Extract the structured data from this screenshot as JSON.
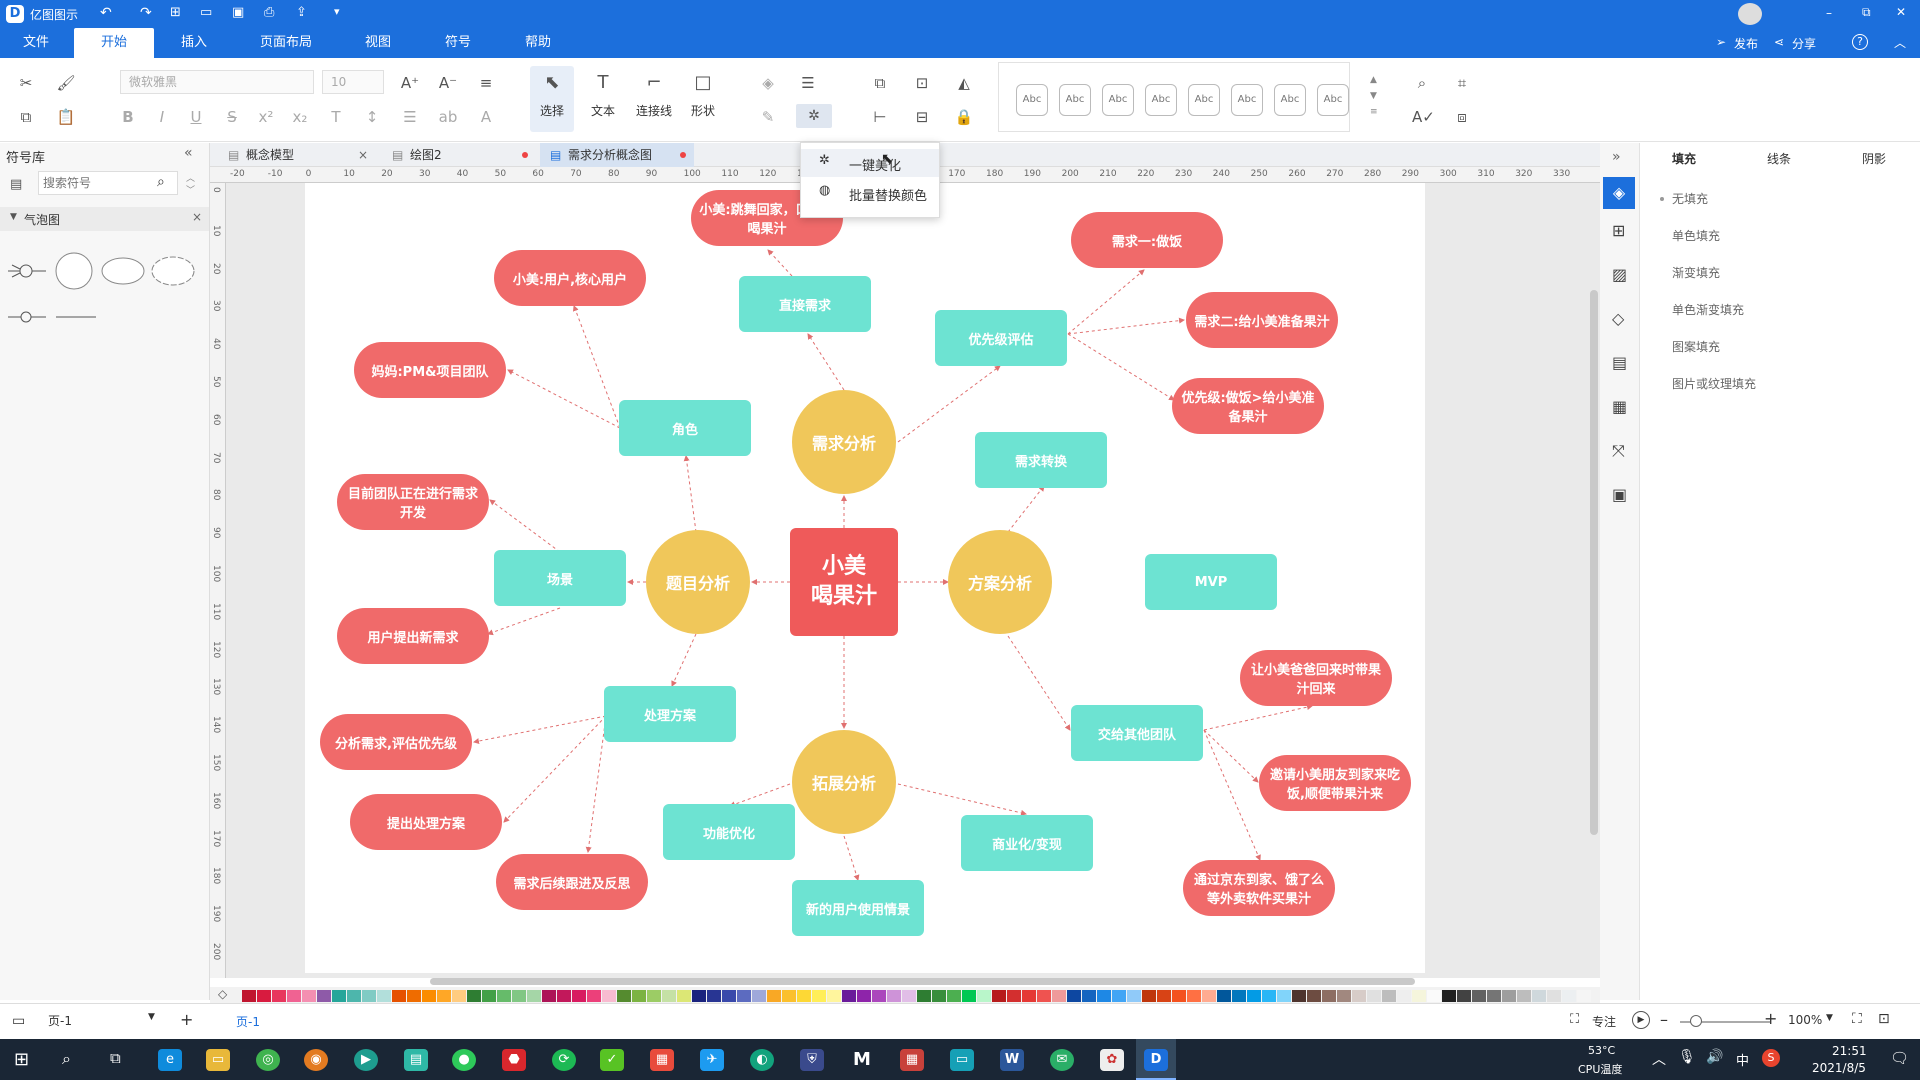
{
  "app": {
    "title": "亿图图示"
  },
  "window_controls": {
    "minimize": "–",
    "restore": "⧉",
    "close": "✕"
  },
  "menu": {
    "tabs": [
      "文件",
      "开始",
      "插入",
      "页面布局",
      "视图",
      "符号",
      "帮助"
    ],
    "active": "开始",
    "publish": "发布",
    "share": "分享",
    "help": "?"
  },
  "ribbon": {
    "font_family": "微软雅黑",
    "font_size": "10",
    "tools": [
      "选择",
      "文本",
      "连接线",
      "形状"
    ],
    "style_swatches": [
      "Abc",
      "Abc",
      "Abc",
      "Abc",
      "Abc",
      "Abc",
      "Abc",
      "Abc"
    ]
  },
  "context_menu": {
    "items": [
      "一键美化",
      "批量替换颜色"
    ]
  },
  "symbol_library": {
    "title": "符号库",
    "search_placeholder": "搜索符号",
    "category": "气泡图"
  },
  "doc_tabs": [
    {
      "label": "概念模型",
      "close": "×"
    },
    {
      "label": "绘图2",
      "dot": true
    },
    {
      "label": "需求分析概念图",
      "dot": true,
      "active": true
    }
  ],
  "ruler": {
    "h_ticks": [
      "-20",
      "-10",
      "0",
      "10",
      "20",
      "30",
      "40",
      "50",
      "60",
      "70",
      "80",
      "90",
      "100",
      "110",
      "120",
      "130",
      "140",
      "150",
      "160",
      "170",
      "180",
      "190",
      "200",
      "210",
      "220",
      "230",
      "240",
      "250",
      "260",
      "270",
      "280",
      "290",
      "300",
      "310",
      "320",
      "330"
    ],
    "v_ticks": [
      "0",
      "10",
      "20",
      "30",
      "40",
      "50",
      "60",
      "70",
      "80",
      "90",
      "100",
      "110",
      "120",
      "130",
      "140",
      "150",
      "160",
      "170",
      "180",
      "190",
      "200"
    ]
  },
  "mindmap": {
    "center": "小美\n喝果汁",
    "hubs": {
      "xuqiu": "需求分析",
      "timu": "题目分析",
      "fangan": "方案分析",
      "tuozhan": "拓展分析"
    },
    "teal_nodes": {
      "zhijie": "直接需求",
      "youxian": "优先级评估",
      "jiaose": "角色",
      "xuqiuzhuanhuan": "需求转换",
      "changjing": "场景",
      "mvp": "MVP",
      "chuli": "处理方案",
      "jiaogei": "交给其他团队",
      "gongneng": "功能优化",
      "shangye": "商业化/变现",
      "xinyonghu": "新的用户使用情景"
    },
    "red_nodes": {
      "tiaowu": "小美:跳舞回家，口渴想喝果汁",
      "yonghu": "小美:用户,核心用户",
      "mama": "妈妈:PM&项目团队",
      "xuqiu1": "需求一:做饭",
      "xuqiu2": "需求二:给小美准备果汁",
      "youxianji": "优先级:做饭>给小美准备果汁",
      "tuandui": "目前团队正在进行需求开发",
      "tichu": "用户提出新需求",
      "fenxi": "分析需求,评估优先级",
      "tichufangan": "提出处理方案",
      "genjin": "需求后续跟进及反思",
      "baba": "让小美爸爸回来时带果汁回来",
      "pengyou": "邀请小美朋友到家来吃饭,顺便带果汁来",
      "jingdong": "通过京东到家、饿了么等外卖软件买果汁"
    }
  },
  "right_panel": {
    "tabs": [
      "填充",
      "线条",
      "阴影"
    ],
    "active": "填充",
    "fill_options": [
      "无填充",
      "单色填充",
      "渐变填充",
      "单色渐变填充",
      "图案填充",
      "图片或纹理填充"
    ]
  },
  "status": {
    "page_select": "页-1",
    "page_tab": "页-1",
    "add": "+",
    "focus": "专注",
    "zoom": "100%"
  },
  "taskbar": {
    "temp": "53°C",
    "cpu": "CPU温度",
    "ime": "中",
    "time": "21:51",
    "date": "2021/8/5"
  },
  "colors": {
    "brand": "#1c6fdc",
    "node_red": "#f06a6a",
    "node_teal": "#6de3d2",
    "node_gold": "#f0c75a"
  }
}
